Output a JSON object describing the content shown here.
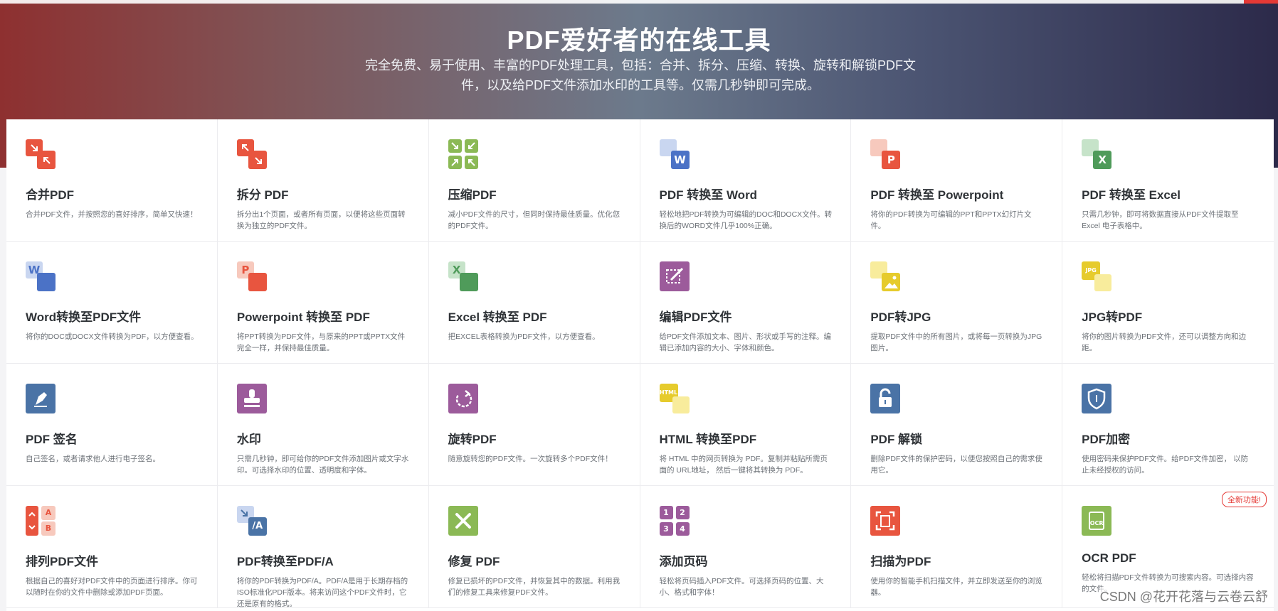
{
  "hero": {
    "title": "PDF爱好者的在线工具",
    "subtitle": "完全免费、易于使用、丰富的PDF处理工具，包括：合并、拆分、压缩、转换、旋转和解锁PDF文件，以及给PDF文件添加水印的工具等。仅需几秒钟即可完成。"
  },
  "tools": [
    {
      "id": "merge",
      "icon": "merge-pdf-icon",
      "name": "合并PDF",
      "desc": "合并PDF文件，并按照您的喜好排序，简单又快速！"
    },
    {
      "id": "split",
      "icon": "split-pdf-icon",
      "name": "拆分 PDF",
      "desc": "拆分出1个页面，或者所有页面，以便将这些页面转换为独立的PDF文件。"
    },
    {
      "id": "compress",
      "icon": "compress-pdf-icon",
      "name": "压缩PDF",
      "desc": "减小PDF文件的尺寸，但同时保持最佳质量。优化您的PDF文件。"
    },
    {
      "id": "pdf2word",
      "icon": "pdf-to-word-icon",
      "name": "PDF 转换至 Word",
      "desc": "轻松地把PDF转换为可编辑的DOC和DOCX文件。转换后的WORD文件几乎100%正确。"
    },
    {
      "id": "pdf2ppt",
      "icon": "pdf-to-powerpoint-icon",
      "name": "PDF 转换至 Powerpoint",
      "desc": "将你的PDF转换为可编辑的PPT和PPTX幻灯片文件。"
    },
    {
      "id": "pdf2excel",
      "icon": "pdf-to-excel-icon",
      "name": "PDF 转换至 Excel",
      "desc": "只需几秒钟，即可将数据直接从PDF文件提取至Excel 电子表格中。"
    },
    {
      "id": "word2pdf",
      "icon": "word-to-pdf-icon",
      "name": "Word转换至PDF文件",
      "desc": "将你的DOC或DOCX文件转换为PDF，以方便查看。"
    },
    {
      "id": "ppt2pdf",
      "icon": "powerpoint-to-pdf-icon",
      "name": "Powerpoint 转换至 PDF",
      "desc": "将PPT转换为PDF文件，与原来的PPT或PPTX文件完全一样，并保持最佳质量。"
    },
    {
      "id": "excel2pdf",
      "icon": "excel-to-pdf-icon",
      "name": "Excel 转换至 PDF",
      "desc": "把EXCEL表格转换为PDF文件，以方便查看。"
    },
    {
      "id": "edit",
      "icon": "edit-pdf-icon",
      "name": "编辑PDF文件",
      "desc": "给PDF文件添加文本、图片、形状或手写的注释。编辑已添加内容的大小、字体和颜色。"
    },
    {
      "id": "pdf2jpg",
      "icon": "pdf-to-jpg-icon",
      "name": "PDF转JPG",
      "desc": "提取PDF文件中的所有图片，或将每一页转换为JPG图片。"
    },
    {
      "id": "jpg2pdf",
      "icon": "jpg-to-pdf-icon",
      "name": "JPG转PDF",
      "desc": "将你的图片转换为PDF文件，还可以调整方向和边距。"
    },
    {
      "id": "sign",
      "icon": "sign-pdf-icon",
      "name": "PDF 签名",
      "desc": "自己签名，或者请求他人进行电子签名。"
    },
    {
      "id": "watermark",
      "icon": "watermark-icon",
      "name": "水印",
      "desc": "只需几秒钟，即可给你的PDF文件添加图片或文字水印。可选择水印的位置、透明度和字体。"
    },
    {
      "id": "rotate",
      "icon": "rotate-pdf-icon",
      "name": "旋转PDF",
      "desc": "随意旋转您的PDF文件。一次旋转多个PDF文件！"
    },
    {
      "id": "html2pdf",
      "icon": "html-to-pdf-icon",
      "name": "HTML 转换至PDF",
      "desc": "将 HTML 中的网页转换为 PDF。复制并粘贴所需页面的 URL地址， 然后一键将其转换为 PDF。"
    },
    {
      "id": "unlock",
      "icon": "unlock-pdf-icon",
      "name": "PDF 解锁",
      "desc": "删除PDF文件的保护密码，以便您按照自己的需求使用它。"
    },
    {
      "id": "protect",
      "icon": "protect-pdf-icon",
      "name": "PDF加密",
      "desc": "使用密码来保护PDF文件。给PDF文件加密， 以防止未经授权的访问。"
    },
    {
      "id": "organize",
      "icon": "organize-pdf-icon",
      "name": "排列PDF文件",
      "desc": "根据自己的喜好对PDF文件中的页面进行排序。你可以随时在你的文件中删除或添加PDF页面。"
    },
    {
      "id": "pdfa",
      "icon": "pdf-to-pdfa-icon",
      "name": "PDF转换至PDF/A",
      "desc": "将你的PDF转换为PDF/A。PDF/A是用于长期存档的ISO标准化PDF版本。将来访问这个PDF文件时，它还是原有的格式。"
    },
    {
      "id": "repair",
      "icon": "repair-pdf-icon",
      "name": "修复 PDF",
      "desc": "修复已损坏的PDF文件，并恢复其中的数据。利用我们的修复工具来修复PDF文件。"
    },
    {
      "id": "pagenum",
      "icon": "page-numbers-icon",
      "name": "添加页码",
      "desc": "轻松将页码插入PDF文件。可选择页码的位置、大小、格式和字体！"
    },
    {
      "id": "scan",
      "icon": "scan-to-pdf-icon",
      "name": "扫描为PDF",
      "desc": "使用你的智能手机扫描文件，并立即发送至你的浏览器。"
    },
    {
      "id": "ocr",
      "icon": "ocr-pdf-icon",
      "name": "OCR PDF",
      "desc": "轻松将扫描PDF文件转换为可搜索内容。可选择内容的文件。",
      "badge": "全新功能!"
    }
  ],
  "icon_text": {
    "word": "W",
    "ppt": "P",
    "excel": "X",
    "jpg": "JPG",
    "html": "HTML",
    "pdfa": "/A",
    "ocr": "OCR",
    "a": "A",
    "b": "B",
    "n1": "1",
    "n2": "2",
    "n3": "3",
    "n4": "4"
  },
  "colors": {
    "orange": "#e8553f",
    "green": "#8bb955",
    "blue": "#4b72c6",
    "purple": "#9c5b9b",
    "yellow": "#e6cb2c",
    "steel": "#4a73a6",
    "excel": "#4f9b5a"
  },
  "watermark": "CSDN @花开花落与云卷云舒"
}
